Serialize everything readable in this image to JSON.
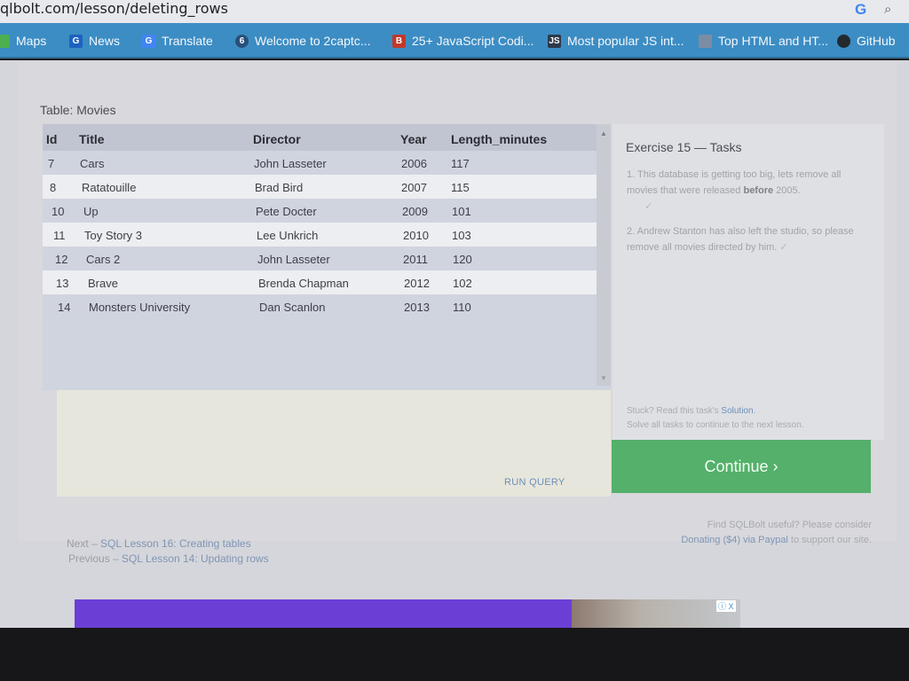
{
  "browser": {
    "url": "qlbolt.com/lesson/deleting_rows",
    "google_glyph": "G",
    "search_glyph": "⌕",
    "bookmarks": [
      {
        "label": "Maps",
        "icon": "maps-icon",
        "color": "#4caf50"
      },
      {
        "label": "News",
        "icon": "news-icon",
        "color": "#1e62c0"
      },
      {
        "label": "Translate",
        "icon": "translate-icon",
        "color": "#4285f4"
      },
      {
        "label": "Welcome to 2captc...",
        "icon": "2captcha-icon",
        "color": "#2a4f7a"
      },
      {
        "label": "25+ JavaScript Codi...",
        "icon": "js-bookmark-icon",
        "color": "#c0392b"
      },
      {
        "label": "Most popular JS int...",
        "icon": "js-logo-icon",
        "color": "#2d3a4a"
      },
      {
        "label": "Top HTML and HT...",
        "icon": "html-icon",
        "color": "#7b8da3"
      },
      {
        "label": "GitHub",
        "icon": "github-icon",
        "color": "#24292e"
      }
    ]
  },
  "lesson": {
    "table_label": "Table: Movies",
    "columns": [
      "Id",
      "Title",
      "Director",
      "Year",
      "Length_minutes"
    ],
    "rows": [
      [
        "7",
        "Cars",
        "John Lasseter",
        "2006",
        "117"
      ],
      [
        "8",
        "Ratatouille",
        "Brad Bird",
        "2007",
        "115"
      ],
      [
        "10",
        "Up",
        "Pete Docter",
        "2009",
        "101"
      ],
      [
        "11",
        "Toy Story 3",
        "Lee Unkrich",
        "2010",
        "103"
      ],
      [
        "12",
        "Cars 2",
        "John Lasseter",
        "2011",
        "120"
      ],
      [
        "13",
        "Brave",
        "Brenda Chapman",
        "2012",
        "102"
      ],
      [
        "14",
        "Monsters University",
        "Dan Scanlon",
        "2013",
        "110"
      ]
    ],
    "run_query_label": "RUN QUERY"
  },
  "tasks": {
    "title": "Exercise 15 — Tasks",
    "task1_num": "1.",
    "task1_pre": "This database is getting too big, lets remove all movies that were released",
    "task1_bold": "before",
    "task1_post": "2005.",
    "task1_check": "✓",
    "task2_num": "2.",
    "task2_text": "Andrew Stanton has also left the studio, so please remove all movies directed by him.",
    "task2_check": "✓",
    "stuck_pre": "Stuck? Read this task's",
    "stuck_link": "Solution",
    "stuck_post": ".",
    "solve_all": "Solve all tasks to continue to the next lesson.",
    "continue_label": "Continue ›"
  },
  "footer": {
    "next_prefix": "Next –",
    "next_link": "SQL Lesson 16: Creating tables",
    "prev_prefix": "Previous –",
    "prev_link": "SQL Lesson 14: Updating rows",
    "useful_text": "Find SQLBolt useful? Please consider",
    "donate_link": "Donating ($4) via Paypal",
    "donate_post": "to support our site."
  },
  "ad": {
    "badge": "ⓘ X"
  }
}
